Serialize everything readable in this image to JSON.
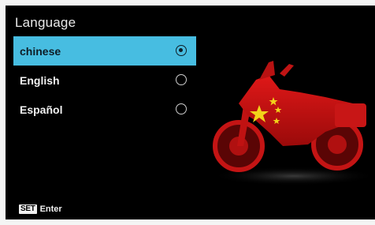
{
  "screen": {
    "title": "Language"
  },
  "languages": [
    {
      "label": "chinese",
      "selected": true
    },
    {
      "label": "English",
      "selected": false
    },
    {
      "label": "Español",
      "selected": false
    }
  ],
  "footer": {
    "key_label": "SET",
    "action_label": "Enter"
  },
  "colors": {
    "highlight": "#47bde1",
    "background": "#000000",
    "bike_red": "#d01010",
    "flag_star": "#f2d21a"
  },
  "icons": {
    "radio_selected": "radio-selected-icon",
    "radio_unselected": "radio-unselected-icon"
  }
}
